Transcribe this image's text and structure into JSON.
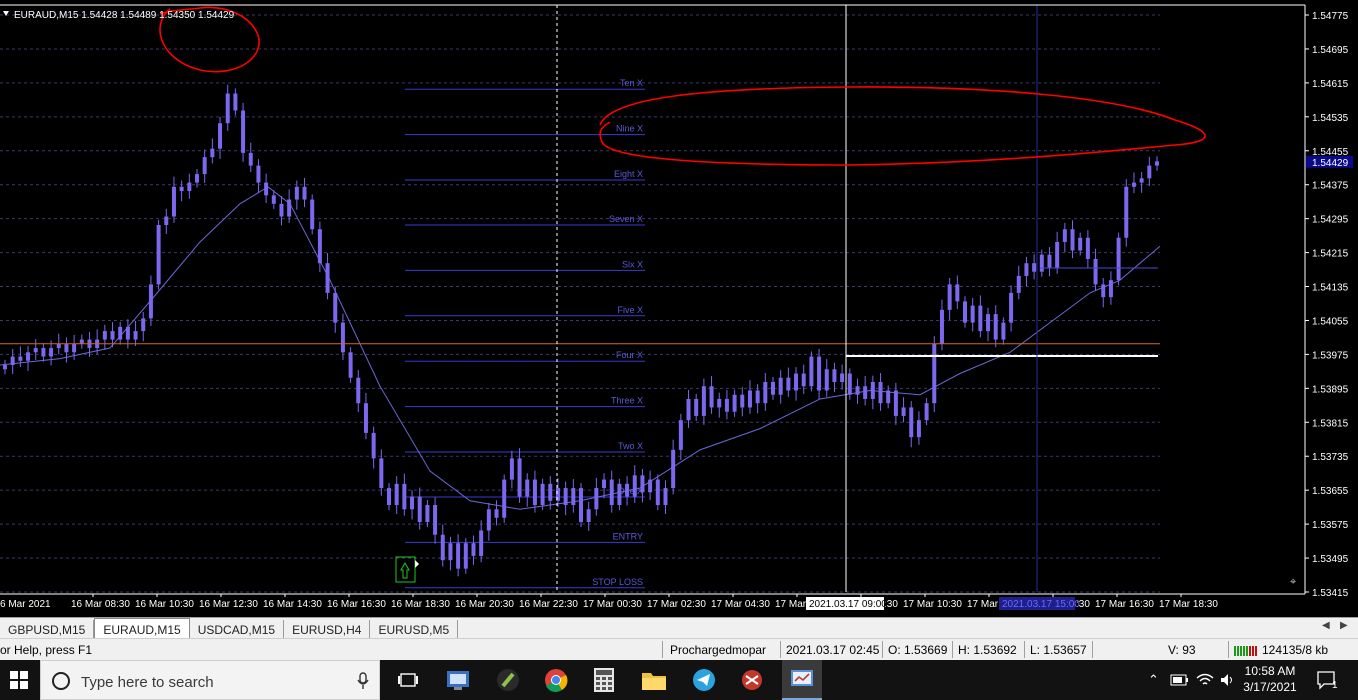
{
  "chart": {
    "header": "EURAUD,M15  1.54428 1.54489 1.54350 1.54429",
    "price_ticks": [
      "1.54775",
      "1.54695",
      "1.54615",
      "1.54535",
      "1.54455",
      "1.54375",
      "1.54295",
      "1.54215",
      "1.54135",
      "1.54055",
      "1.53975",
      "1.53895",
      "1.53815",
      "1.53735",
      "1.53655",
      "1.53575",
      "1.53495",
      "1.53415"
    ],
    "current_price": "1.54429",
    "time_ticks": [
      "6 Mar 2021",
      "16 Mar 08:30",
      "16 Mar 10:30",
      "16 Mar 12:30",
      "16 Mar 14:30",
      "16 Mar 16:30",
      "16 Mar 18:30",
      "16 Mar 20:30",
      "16 Mar 22:30",
      "17 Mar 00:30",
      "17 Mar 02:30",
      "17 Mar 04:30",
      "17 Mar 06:30",
      "17 Mar 08:30",
      "17 Mar 10:30",
      "17 Mar 12:30",
      "17 Mar 14:30",
      "17 Mar 16:30",
      "17 Mar 18:30"
    ],
    "crosshair_time_label": "2021.03.17 09:00",
    "crosshair2_time_label": "2021.03.17 15:00",
    "levels": [
      {
        "label": "Ten X",
        "price": 1.546
      },
      {
        "label": "Nine X",
        "price": 1.54493
      },
      {
        "label": "Eight X",
        "price": 1.54386
      },
      {
        "label": "Seven X",
        "price": 1.5428
      },
      {
        "label": "Six X",
        "price": 1.54173
      },
      {
        "label": "Five X",
        "price": 1.54066
      },
      {
        "label": "Four X",
        "price": 1.53959
      },
      {
        "label": "Three X",
        "price": 1.53852
      },
      {
        "label": "Two X",
        "price": 1.53745
      },
      {
        "label": "One X",
        "price": 1.53639
      },
      {
        "label": "ENTRY",
        "price": 1.53532
      },
      {
        "label": "STOP LOSS",
        "price": 1.53425
      }
    ],
    "horizontal_line_price": 1.54,
    "colors": {
      "candle": "#7b68ee",
      "ma": "#6a6ad8",
      "level": "#3b3bd0",
      "grid": "#3a3a6a",
      "orange_line": "#d2691e",
      "annotation": "#ff0000"
    }
  },
  "tabs": [
    "GBPUSD,M15",
    "EURAUD,M15",
    "USDCAD,M15",
    "EURUSD,H4",
    "EURUSD,M5"
  ],
  "active_tab": "EURAUD,M15",
  "status": {
    "help": "or Help, press F1",
    "profile": "Prochargedmopar",
    "datetime": "2021.03.17 02:45",
    "open": "O: 1.53669",
    "high": "H: 1.53692",
    "low": "L: 1.53657",
    "volume": "V: 93",
    "traffic": "124135/8 kb"
  },
  "taskbar": {
    "search_placeholder": "Type here to search",
    "time": "10:58 AM",
    "date": "3/17/2021",
    "notifications": "1"
  }
}
